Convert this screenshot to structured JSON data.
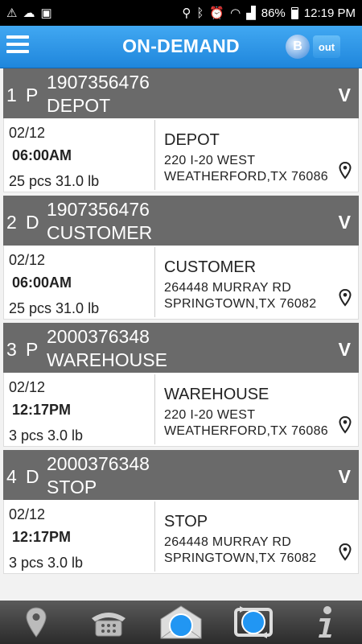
{
  "status_bar": {
    "battery": "86%",
    "time": "12:19 PM"
  },
  "header": {
    "title": "ON-DEMAND",
    "bluetooth_label": "B",
    "out_label": "out"
  },
  "stops": [
    {
      "seq": "1",
      "type": "P",
      "number": "1907356476",
      "name": "DEPOT",
      "expand": "V",
      "date": "02/12",
      "time": "06:00AM",
      "qty": "25 pcs  31.0 lb",
      "company": "DEPOT",
      "address1": "220 I-20 WEST",
      "address2": "WEATHERFORD,TX 76086"
    },
    {
      "seq": "2",
      "type": "D",
      "number": "1907356476",
      "name": "CUSTOMER",
      "expand": "V",
      "date": "02/12",
      "time": "06:00AM",
      "qty": "25 pcs  31.0 lb",
      "company": "CUSTOMER",
      "address1": "264448 MURRAY RD",
      "address2": "SPRINGTOWN,TX 76082"
    },
    {
      "seq": "3",
      "type": "P",
      "number": "2000376348",
      "name": "WAREHOUSE",
      "expand": "V",
      "date": "02/12",
      "time": "12:17PM",
      "qty": "3 pcs  3.0 lb",
      "company": "WAREHOUSE",
      "address1": "220 I-20 WEST",
      "address2": "WEATHERFORD,TX 76086"
    },
    {
      "seq": "4",
      "type": "D",
      "number": "2000376348",
      "name": "STOP",
      "expand": "V",
      "date": "02/12",
      "time": "12:17PM",
      "qty": "3 pcs  3.0 lb",
      "company": "STOP",
      "address1": "264448 MURRAY RD",
      "address2": "SPRINGTOWN,TX 76082"
    }
  ],
  "bottom_nav": [
    {
      "icon": "location-pin-icon"
    },
    {
      "icon": "phone-icon"
    },
    {
      "icon": "mail-icon"
    },
    {
      "icon": "sync-icon"
    },
    {
      "icon": "info-icon"
    }
  ],
  "colors": {
    "header": "#2a92e6",
    "stop_header": "#6a6a6a",
    "accent": "#2196f3"
  }
}
